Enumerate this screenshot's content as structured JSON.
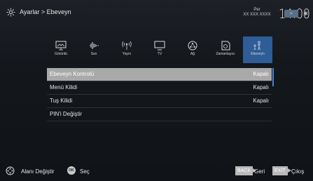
{
  "header": {
    "breadcrumb": "Ayarlar > Ebeveyn",
    "date_day": "Per",
    "date_value": "XX XXX XXXX",
    "time": "14:00",
    "wifi_label": "≈",
    "bt_label": "✱"
  },
  "tabs": [
    {
      "label": "Görüntü",
      "icon": "picture-icon"
    },
    {
      "label": "Ses",
      "icon": "sound-icon"
    },
    {
      "label": "Yayın",
      "icon": "broadcast-icon"
    },
    {
      "label": "TV",
      "icon": "tv-icon"
    },
    {
      "label": "Ağ",
      "icon": "network-icon"
    },
    {
      "label": "Zamanlayıcı",
      "icon": "timer-icon"
    },
    {
      "label": "Ebeveyn",
      "icon": "parental-icon",
      "active": true
    }
  ],
  "menu": [
    {
      "label": "Ebeveyn Kontrolü",
      "value": "Kapalı",
      "selected": true
    },
    {
      "label": "Menü Kilidi",
      "value": "Kapalı"
    },
    {
      "label": "Tuş Kilidi",
      "value": "Kapalı"
    },
    {
      "label": "PIN'i Değiştir",
      "value": ""
    }
  ],
  "footer": {
    "navigate_label": "Alanı Değiştir",
    "ok_key": "OK",
    "select_label": "Seç",
    "back_key": "BACK",
    "back_label": "Geri",
    "exit_key": "EXIT",
    "exit_label": "Çıkış"
  },
  "colors": {
    "accent": "#2e5d98",
    "selected_row": "#a9a9a9",
    "scrollbar": "#4a86cc"
  }
}
